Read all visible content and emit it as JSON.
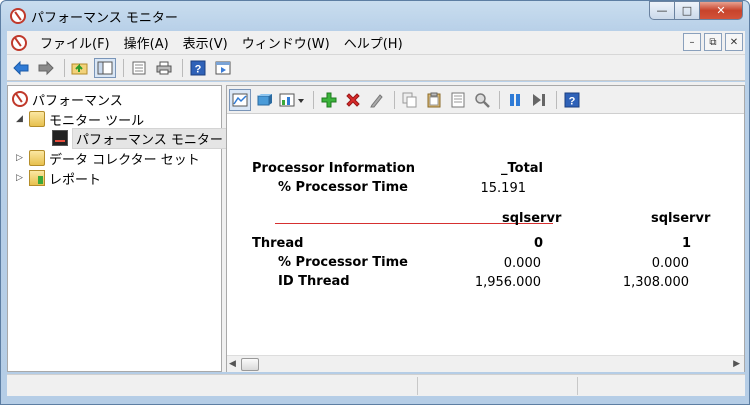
{
  "window": {
    "title": "パフォーマンス モニター",
    "buttons": {
      "minimize": "—",
      "maximize": "□",
      "close": "✕"
    }
  },
  "menubar": {
    "items": [
      "ファイル(F)",
      "操作(A)",
      "表示(V)",
      "ウィンドウ(W)",
      "ヘルプ(H)"
    ],
    "mdi": {
      "minimize": "–",
      "restore": "⧉",
      "close": "✕"
    }
  },
  "toolbar": {
    "icons": [
      "back-icon",
      "forward-icon",
      "up-folder-icon",
      "show-hide-tree-icon",
      "export-list-icon",
      "print-icon",
      "help-icon",
      "properties-icon"
    ]
  },
  "tree": {
    "items": [
      {
        "label": "パフォーマンス",
        "icon": "performance-icon"
      },
      {
        "label": "モニター ツール",
        "icon": "folder-icon"
      },
      {
        "label": "パフォーマンス モニター",
        "icon": "monitor-icon"
      },
      {
        "label": "データ コレクター セット",
        "icon": "folder-icon"
      },
      {
        "label": "レポート",
        "icon": "report-icon"
      }
    ]
  },
  "report": {
    "section1": {
      "object": "Processor Information",
      "instance": "_Total",
      "counter": "% Processor Time",
      "value": "15.191"
    },
    "section2": {
      "object": "Thread",
      "instances": [
        {
          "name": "sqlservr",
          "index": "0",
          "processor_time": "0.000",
          "id_thread": "1,956.000"
        },
        {
          "name": "sqlservr",
          "index": "1",
          "processor_time": "0.000",
          "id_thread": "1,308.000"
        }
      ],
      "counters": [
        "% Processor Time",
        "ID Thread"
      ]
    },
    "highlight_color": "#d63030"
  }
}
